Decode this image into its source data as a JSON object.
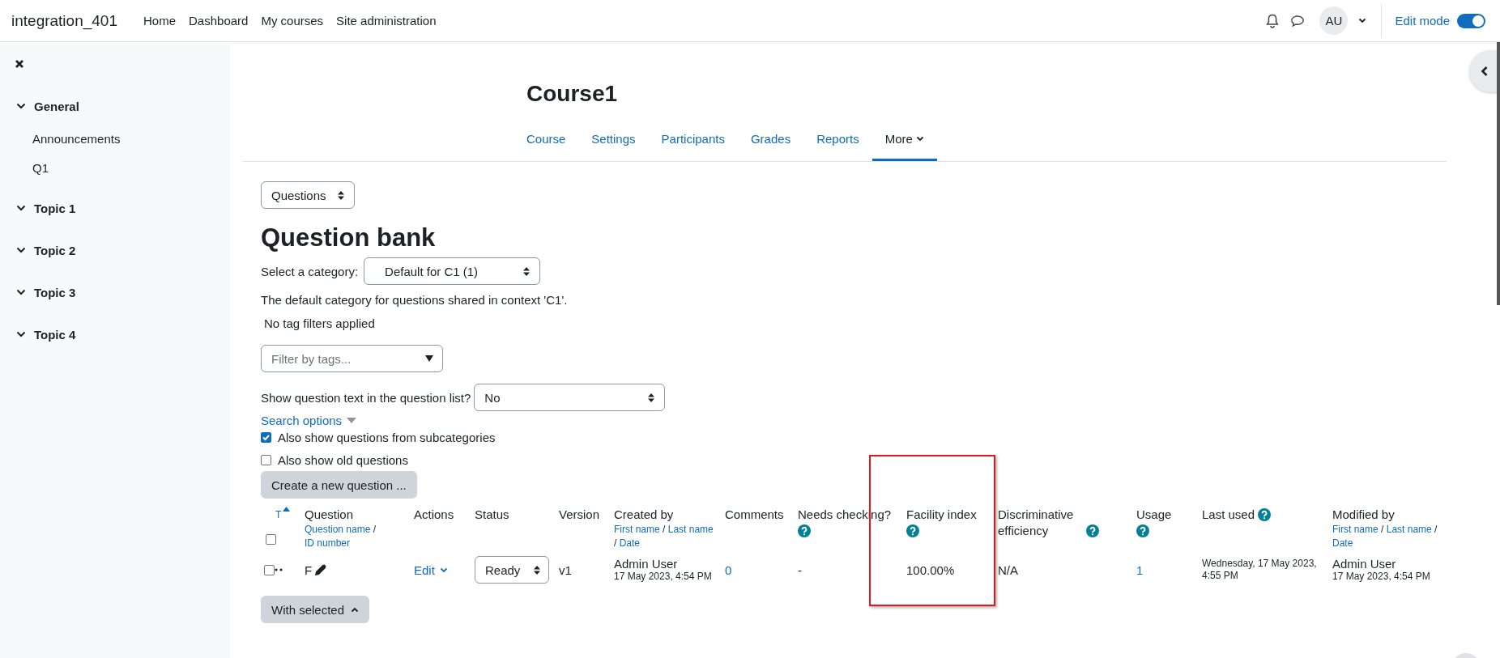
{
  "navbar": {
    "site_name": "integration_401",
    "links": [
      {
        "label": "Home",
        "selected": false
      },
      {
        "label": "Dashboard",
        "selected": false
      },
      {
        "label": "My courses",
        "selected": false
      },
      {
        "label": "Site administration",
        "selected": false
      }
    ],
    "avatar": "AU",
    "edit_mode": {
      "label": "Edit mode",
      "on": true
    }
  },
  "sidebar": {
    "sections": [
      {
        "label": "General",
        "expanded": true,
        "children": [
          {
            "label": "Announcements"
          },
          {
            "label": "Q1"
          }
        ]
      },
      {
        "label": "Topic 1",
        "expanded": true
      },
      {
        "label": "Topic 2",
        "expanded": true
      },
      {
        "label": "Topic 3",
        "expanded": true
      },
      {
        "label": "Topic 4",
        "expanded": true
      }
    ]
  },
  "course": {
    "title": "Course1",
    "tabs": [
      {
        "label": "Course",
        "selected": false,
        "kind": "link"
      },
      {
        "label": "Settings",
        "selected": false,
        "kind": "link"
      },
      {
        "label": "Participants",
        "selected": false,
        "kind": "link"
      },
      {
        "label": "Grades",
        "selected": false,
        "kind": "link"
      },
      {
        "label": "Reports",
        "selected": false,
        "kind": "link"
      },
      {
        "label": "More",
        "selected": true,
        "kind": "menu"
      }
    ]
  },
  "page_select": {
    "value": "Questions"
  },
  "heading": "Question bank",
  "category": {
    "label": "Select a category:",
    "value": "Default for C1 (1)",
    "description": "The default category for questions shared in context 'C1'."
  },
  "tag_status": "No tag filters applied",
  "tag_filter": {
    "placeholder": "Filter by tags..."
  },
  "show_text": {
    "label": "Show question text in the question list?",
    "value": "No"
  },
  "search_options": "Search options",
  "options": [
    {
      "label": "Also show questions from subcategories",
      "checked": true
    },
    {
      "label": "Also show old questions",
      "checked": false
    }
  ],
  "create_button": "Create a new question ...",
  "table": {
    "columns": [
      {
        "kind": "select",
        "label": "T",
        "checked": false
      },
      {
        "kind": "sortable",
        "label": "Question",
        "links": [
          {
            "kind": "link",
            "text": "Question name"
          },
          {
            "kind": "sep",
            "text": "/"
          },
          {
            "kind": "link",
            "text": "ID number"
          }
        ]
      },
      {
        "kind": "plain",
        "label": "Actions"
      },
      {
        "kind": "plain",
        "label": "Status"
      },
      {
        "kind": "plain",
        "label": "Version"
      },
      {
        "kind": "sortable",
        "label": "Created by",
        "links": [
          {
            "kind": "link",
            "text": "First name"
          },
          {
            "kind": "sep",
            "text": "/"
          },
          {
            "kind": "link",
            "text": "Last name"
          },
          {
            "kind": "sep",
            "text": "/"
          },
          {
            "kind": "link",
            "text": "Date"
          }
        ]
      },
      {
        "kind": "plain",
        "label": "Comments"
      },
      {
        "kind": "help-below",
        "label": "Needs checking?"
      },
      {
        "kind": "help-below",
        "label": "Facility index"
      },
      {
        "kind": "help-inline",
        "label": "Discriminative efficiency"
      },
      {
        "kind": "help-below",
        "label": "Usage"
      },
      {
        "kind": "help-inline",
        "label": "Last used"
      },
      {
        "kind": "sortable",
        "label": "Modified by",
        "links": [
          {
            "kind": "link",
            "text": "First name"
          },
          {
            "kind": "sep",
            "text": "/"
          },
          {
            "kind": "link",
            "text": "Last name"
          },
          {
            "kind": "sep",
            "text": "/"
          },
          {
            "kind": "link",
            "text": "Date"
          }
        ]
      }
    ],
    "rows": [
      {
        "cells": [
          {
            "kind": "select",
            "checked": false
          },
          {
            "kind": "question",
            "text": "F"
          },
          {
            "kind": "menu-link",
            "text": "Edit"
          },
          {
            "kind": "select-field",
            "text": "Ready"
          },
          {
            "kind": "text",
            "text": "v1"
          },
          {
            "kind": "user-date",
            "name": "Admin User",
            "date": "17 May 2023, 4:54 PM"
          },
          {
            "kind": "link",
            "text": "0"
          },
          {
            "kind": "text",
            "text": "-"
          },
          {
            "kind": "text",
            "text": "100.00%"
          },
          {
            "kind": "text",
            "text": "N/A"
          },
          {
            "kind": "link",
            "text": "1"
          },
          {
            "kind": "small-text",
            "text": "Wednesday, 17 May 2023, 4:55 PM"
          },
          {
            "kind": "user-date",
            "name": "Admin User",
            "date": "17 May 2023, 4:54 PM"
          }
        ]
      }
    ]
  },
  "with_selected": "With selected",
  "highlight": true
}
